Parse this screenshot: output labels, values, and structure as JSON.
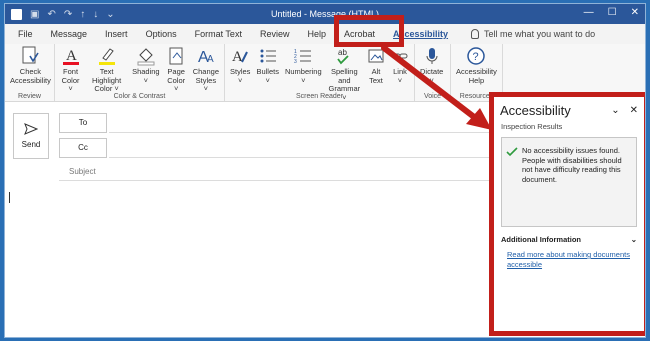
{
  "window": {
    "title": "Untitled  -  Message (HTML)",
    "min_glyph": "—",
    "max_glyph": "☐",
    "close_glyph": "✕"
  },
  "tabs": [
    {
      "label": "File"
    },
    {
      "label": "Message"
    },
    {
      "label": "Insert"
    },
    {
      "label": "Options"
    },
    {
      "label": "Format Text"
    },
    {
      "label": "Review"
    },
    {
      "label": "Help"
    },
    {
      "label": "Acrobat"
    },
    {
      "label": "Accessibility"
    }
  ],
  "tellme": {
    "text": "Tell me what you want to do"
  },
  "ribbon": {
    "review": {
      "label": "Review",
      "check": "Check\nAccessibility"
    },
    "color": {
      "label": "Color & Contrast",
      "font_color": "Font\nColor ˅",
      "highlight": "Text Highlight\nColor ˅",
      "shading": "Shading\n˅",
      "page_color": "Page\nColor ˅",
      "styles": "Change\nStyles ˅"
    },
    "screen_reader": {
      "label": "Screen Reader",
      "styles": "Styles\n˅",
      "bullets": "Bullets\n˅",
      "numbering": "Numbering\n˅",
      "spelling": "Spelling and\nGrammar ˅",
      "alt_text": "Alt\nText",
      "link": "Link\n˅"
    },
    "voice": {
      "label": "Voice",
      "dictate": "Dictate\n˅"
    },
    "resources": {
      "label": "Resources",
      "help": "Accessibility\nHelp"
    }
  },
  "compose": {
    "send": "Send",
    "to": "To",
    "cc": "Cc",
    "subject": "Subject"
  },
  "pane": {
    "title": "Accessibility",
    "inspection_label": "Inspection Results",
    "result_text": "No accessibility issues found. People with disabilities should not have difficulty reading this document.",
    "additional": "Additional Information",
    "link": "Read more about making documents accessible"
  },
  "colors": {
    "titlebar": "#2b579a",
    "callout": "#c21f1a",
    "accent_blue": "#2b579a",
    "font_red": "#e81123",
    "highlight_yellow": "#f5e50a"
  }
}
